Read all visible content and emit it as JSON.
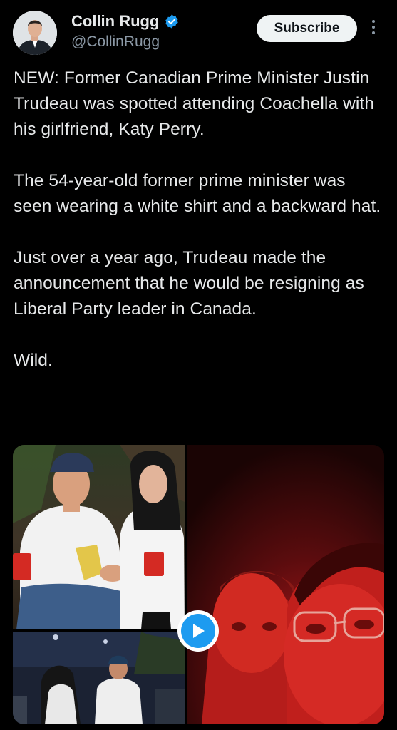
{
  "author": {
    "display_name": "Collin Rugg",
    "handle": "@CollinRugg",
    "verified": true,
    "avatar_icon": "avatar-photo"
  },
  "actions": {
    "subscribe_label": "Subscribe",
    "more_icon": "more-vertical-icon"
  },
  "tweet": {
    "paragraphs": [
      "NEW: Former Canadian Prime Minister Justin Trudeau was spotted attending Coachella with his girlfriend, Katy Perry.",
      "The 54-year-old former prime minister was seen wearing a white shirt and a backward hat.",
      "Just over a year ago, Trudeau made the announcement that he would be resigning as Liberal Party leader in Canada.",
      "Wild."
    ]
  },
  "media": {
    "items": [
      {
        "kind": "photo"
      },
      {
        "kind": "photo"
      },
      {
        "kind": "video"
      }
    ],
    "play_icon": "play-icon"
  },
  "colors": {
    "background": "#000000",
    "text": "#e7e9ea",
    "secondary_text": "#8b98a5",
    "verified_blue": "#1d9bf0",
    "button_bg": "#eff3f4"
  }
}
